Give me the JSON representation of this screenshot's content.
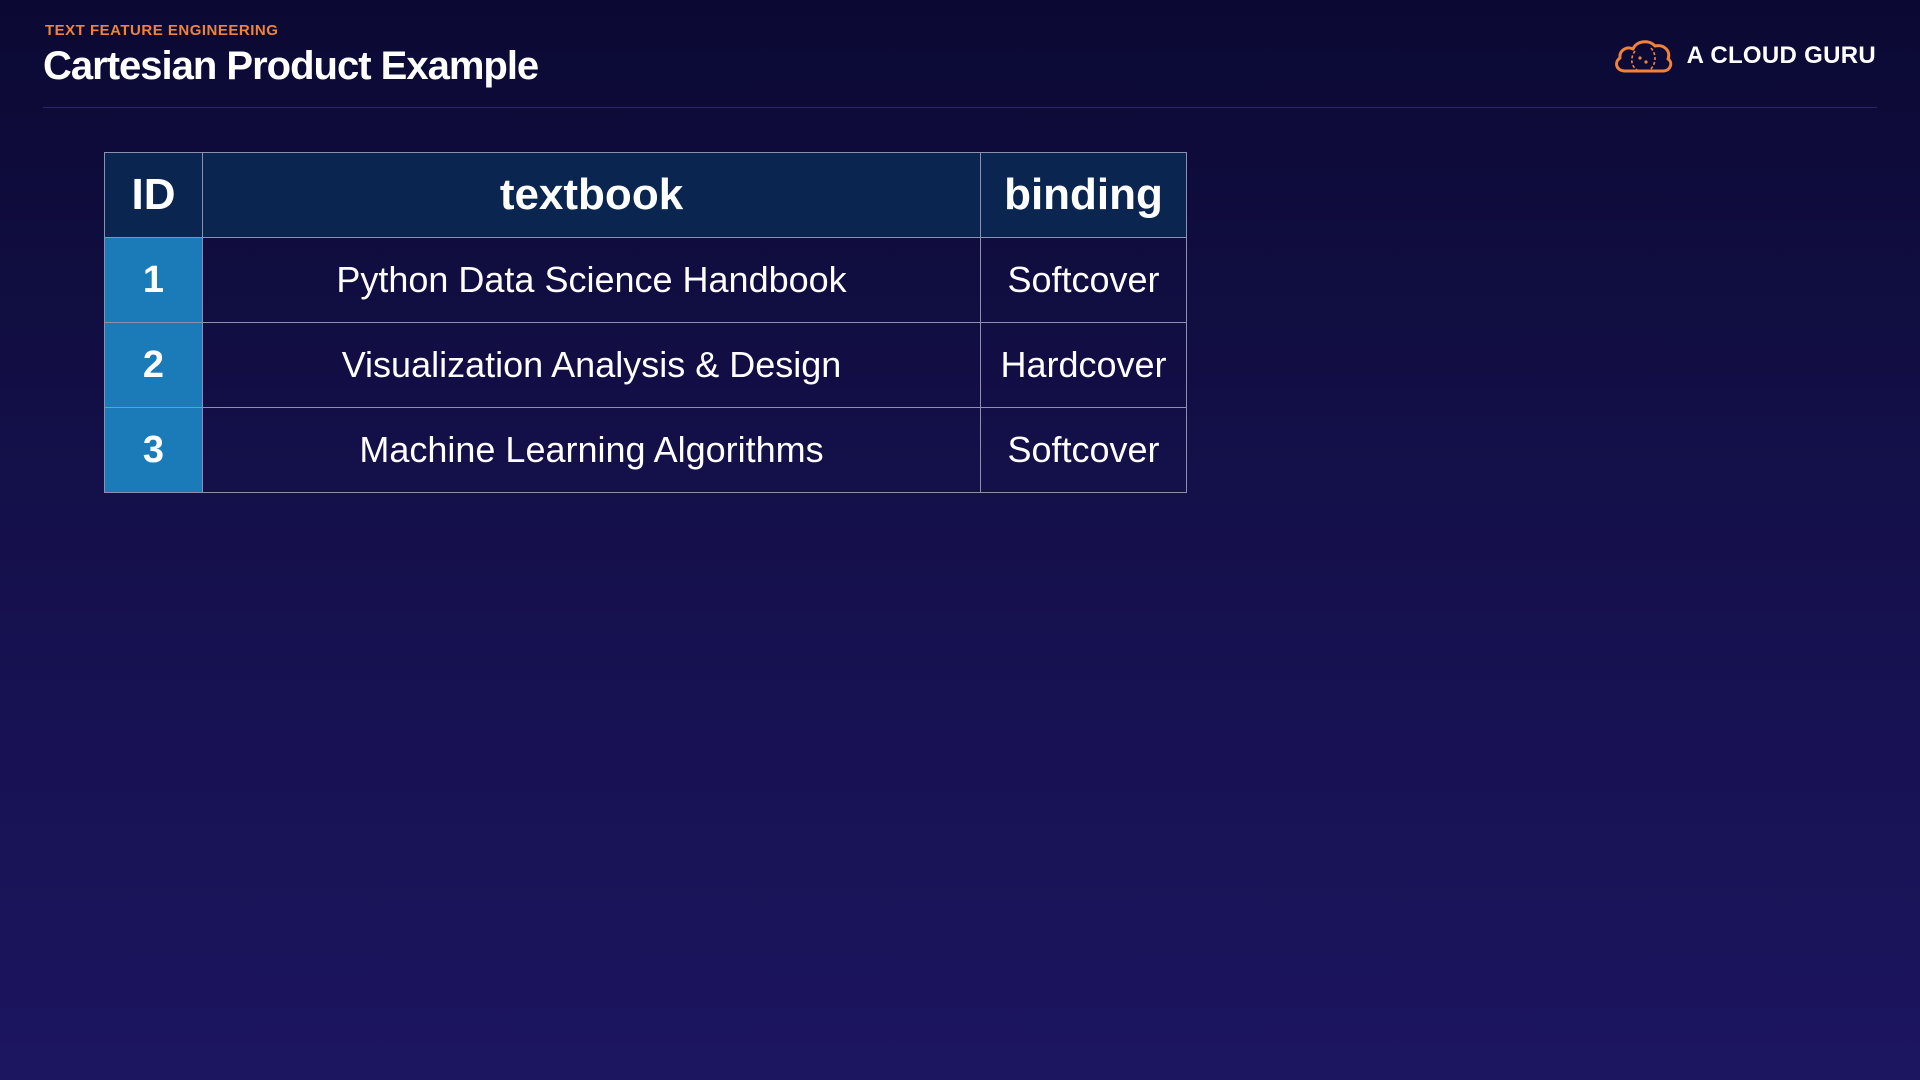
{
  "header": {
    "eyebrow": "TEXT FEATURE ENGINEERING",
    "title": "Cartesian Product Example",
    "brand_name": "A CLOUD GURU",
    "brand_icon": "cloud-logo-icon",
    "accent_color": "#f0823c"
  },
  "table": {
    "columns": [
      "ID",
      "textbook",
      "binding"
    ],
    "rows": [
      {
        "id": "1",
        "textbook": "Python Data Science Handbook",
        "binding": "Softcover"
      },
      {
        "id": "2",
        "textbook": "Visualization Analysis & Design",
        "binding": "Hardcover"
      },
      {
        "id": "3",
        "textbook": "Machine Learning Algorithms",
        "binding": "Softcover"
      }
    ],
    "header_color": "#0a2650",
    "id_cell_color": "#1a7bb8"
  }
}
